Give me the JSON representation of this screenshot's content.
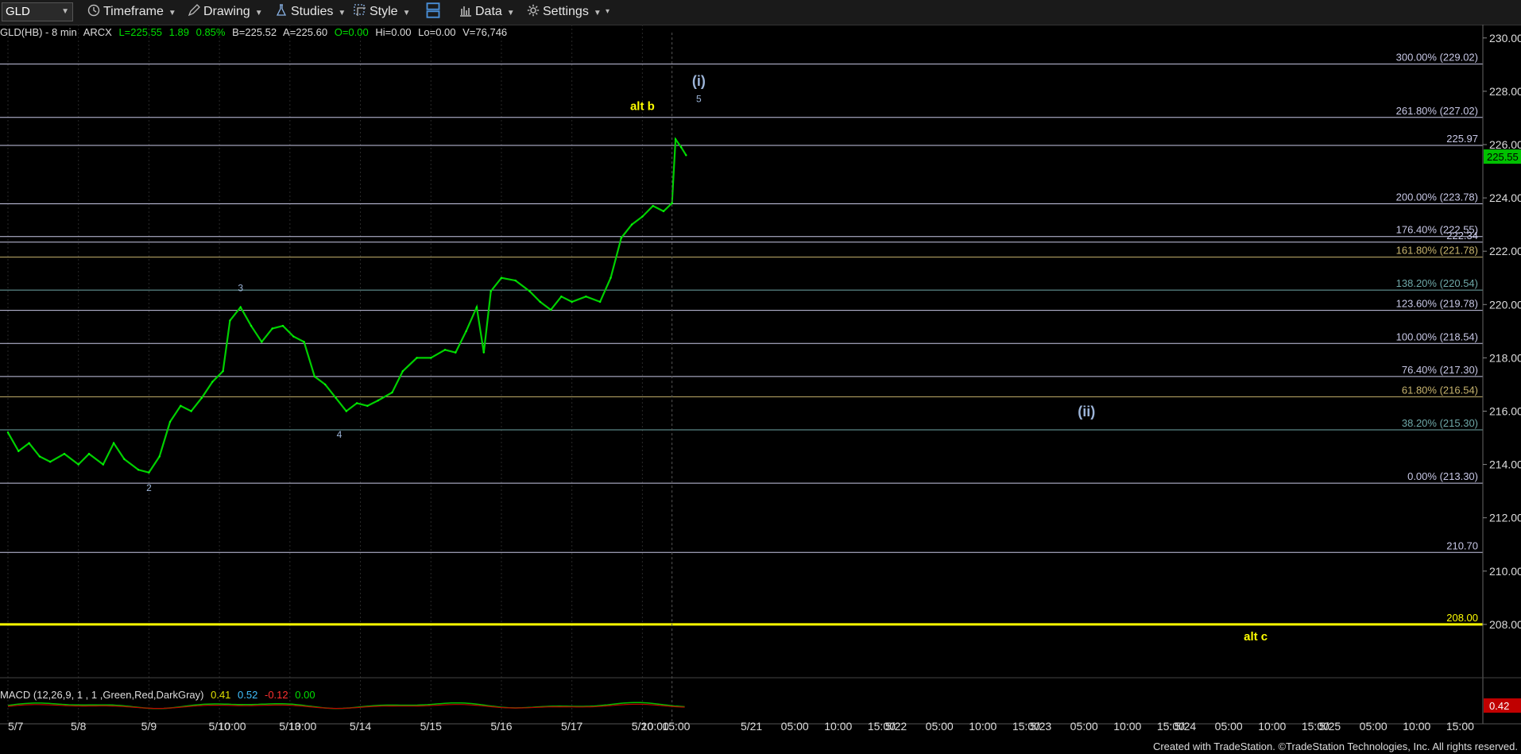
{
  "toolbar": {
    "symbol": "GLD",
    "timeframe": "Timeframe",
    "drawing": "Drawing",
    "studies": "Studies",
    "style": "Style",
    "data": "Data",
    "settings": "Settings"
  },
  "legend": {
    "name": "GLD(HB) - 8 min",
    "exchange": "ARCX",
    "last": "L=225.55",
    "change": "1.89",
    "change_pct": "0.85%",
    "bid": "B=225.52",
    "ask": "A=225.60",
    "open": "O=0.00",
    "high": "Hi=0.00",
    "low": "Lo=0.00",
    "volume": "V=76,746"
  },
  "macd": {
    "label": "MACD (12,26,9, 1 , 1 ,Green,Red,DarkGray)",
    "v1": "0.41",
    "v2": "0.52",
    "v3": "-0.12",
    "v4": "0.00",
    "last_tag": "0.42"
  },
  "price_axis": {
    "ticks": [
      "230.00",
      "228.00",
      "226.00",
      "224.00",
      "222.00",
      "220.00",
      "218.00",
      "216.00",
      "214.00",
      "212.00",
      "210.00",
      "208.00"
    ],
    "last_price": "225.55",
    "last_color": "#00c000"
  },
  "time_axis": {
    "labels": [
      {
        "t": "5/7",
        "x": 0.0
      },
      {
        "t": "5/8",
        "x": 1.0
      },
      {
        "t": "5/9",
        "x": 2.0
      },
      {
        "t": "5/10",
        "x": 3.0
      },
      {
        "t": "10:00",
        "x": 3.18
      },
      {
        "t": "5/13",
        "x": 4.0
      },
      {
        "t": "10:00",
        "x": 4.18
      },
      {
        "t": "5/14",
        "x": 5.0
      },
      {
        "t": "5/15",
        "x": 6.0
      },
      {
        "t": "5/16",
        "x": 7.0
      },
      {
        "t": "5/17",
        "x": 8.0
      },
      {
        "t": "5/20",
        "x": 9.0
      },
      {
        "t": "10:00",
        "x": 9.18
      },
      {
        "t": "15:00",
        "x": 9.48
      },
      {
        "t": "5/21",
        "x": 10.0
      },
      {
        "t": "05:00",
        "x": 10.3
      },
      {
        "t": "10:00",
        "x": 10.6
      },
      {
        "t": "15:00",
        "x": 10.9
      },
      {
        "t": "5/22",
        "x": 11.0
      },
      {
        "t": "05:00",
        "x": 11.3
      },
      {
        "t": "10:00",
        "x": 11.6
      },
      {
        "t": "15:00",
        "x": 11.9
      },
      {
        "t": "5/23",
        "x": 12.0
      },
      {
        "t": "05:00",
        "x": 12.3
      },
      {
        "t": "10:00",
        "x": 12.6
      },
      {
        "t": "15:00",
        "x": 12.9
      },
      {
        "t": "5/24",
        "x": 13.0
      },
      {
        "t": "05:00",
        "x": 13.3
      },
      {
        "t": "10:00",
        "x": 13.6
      },
      {
        "t": "15:00",
        "x": 13.9
      },
      {
        "t": "5/25",
        "x": 14.0
      },
      {
        "t": "05:00",
        "x": 14.3
      },
      {
        "t": "10:00",
        "x": 14.6
      },
      {
        "t": "15:00",
        "x": 14.9
      }
    ]
  },
  "levels": [
    {
      "label": "300.00% (229.02)",
      "price": 229.02,
      "color": "#c8c8e6"
    },
    {
      "label": "261.80% (227.02)",
      "price": 227.02,
      "color": "#c8c8e6"
    },
    {
      "label": "225.97",
      "price": 225.97,
      "color": "#c8c8e6"
    },
    {
      "label": "200.00% (223.78)",
      "price": 223.78,
      "color": "#c8c8e6"
    },
    {
      "label": "176.40% (222.55)",
      "price": 222.55,
      "color": "#c8c8e6"
    },
    {
      "label": "222.34",
      "price": 222.34,
      "color": "#c8c8e6"
    },
    {
      "label": "161.80% (221.78)",
      "price": 221.78,
      "color": "#c8b46e"
    },
    {
      "label": "138.20% (220.54)",
      "price": 220.54,
      "color": "#6fa8a8"
    },
    {
      "label": "123.60% (219.78)",
      "price": 219.78,
      "color": "#c8c8e6"
    },
    {
      "label": "100.00% (218.54)",
      "price": 218.54,
      "color": "#c8c8e6"
    },
    {
      "label": "76.40% (217.30)",
      "price": 217.3,
      "color": "#c8c8e6"
    },
    {
      "label": "61.80% (216.54)",
      "price": 216.54,
      "color": "#c8b46e"
    },
    {
      "label": "38.20% (215.30)",
      "price": 215.3,
      "color": "#6fa8a8"
    },
    {
      "label": "0.00% (213.30)",
      "price": 213.3,
      "color": "#c8c8e6"
    },
    {
      "label": "210.70",
      "price": 210.7,
      "color": "#c8c8e6"
    },
    {
      "label": "208.00",
      "price": 208.0,
      "color": "#ffff00"
    }
  ],
  "annotations": [
    {
      "text": "2",
      "day": 2.0,
      "price": 213.0,
      "color": "#9cb4d8",
      "size": 12
    },
    {
      "text": "3",
      "day": 3.3,
      "price": 220.5,
      "color": "#9cb4d8",
      "size": 12
    },
    {
      "text": "4",
      "day": 4.7,
      "price": 215.0,
      "color": "#9cb4d8",
      "size": 12
    },
    {
      "text": "alt b",
      "day": 9.0,
      "price": 227.3,
      "color": "#ffff00",
      "size": 15
    },
    {
      "text": "(i)",
      "day": 9.8,
      "price": 228.2,
      "color": "#9cb4d8",
      "size": 18
    },
    {
      "text": "5",
      "day": 9.8,
      "price": 227.6,
      "color": "#9cb4d8",
      "size": 12
    },
    {
      "text": "(ii)",
      "day": 15.3,
      "price": 215.8,
      "color": "#9cb4d8",
      "size": 18
    },
    {
      "text": "alt c",
      "day": 17.7,
      "price": 207.4,
      "color": "#ffff00",
      "size": 15
    }
  ],
  "chart_data": {
    "type": "line",
    "title": "GLD(HB) - 8 min",
    "price_range": [
      206,
      230.5
    ],
    "x_domain": [
      0,
      20.9
    ],
    "series": [
      {
        "points": [
          [
            0.0,
            215.2
          ],
          [
            0.15,
            214.5
          ],
          [
            0.3,
            214.8
          ],
          [
            0.45,
            214.3
          ],
          [
            0.6,
            214.1
          ],
          [
            0.8,
            214.4
          ],
          [
            1.0,
            214.0
          ],
          [
            1.15,
            214.4
          ],
          [
            1.35,
            214.0
          ],
          [
            1.5,
            214.8
          ],
          [
            1.65,
            214.2
          ],
          [
            1.85,
            213.8
          ],
          [
            2.0,
            213.7
          ],
          [
            2.15,
            214.3
          ],
          [
            2.3,
            215.6
          ],
          [
            2.45,
            216.2
          ],
          [
            2.6,
            216.0
          ],
          [
            2.75,
            216.5
          ],
          [
            2.9,
            217.1
          ],
          [
            3.05,
            217.5
          ],
          [
            3.15,
            219.4
          ],
          [
            3.3,
            219.9
          ],
          [
            3.45,
            219.2
          ],
          [
            3.6,
            218.6
          ],
          [
            3.75,
            219.1
          ],
          [
            3.9,
            219.2
          ],
          [
            4.05,
            218.8
          ],
          [
            4.2,
            218.6
          ],
          [
            4.35,
            217.3
          ],
          [
            4.5,
            217.0
          ],
          [
            4.65,
            216.5
          ],
          [
            4.8,
            216.0
          ],
          [
            4.95,
            216.3
          ],
          [
            5.1,
            216.2
          ],
          [
            5.25,
            216.4
          ],
          [
            5.45,
            216.7
          ],
          [
            5.6,
            217.5
          ],
          [
            5.8,
            218.0
          ],
          [
            6.0,
            218.0
          ],
          [
            6.2,
            218.3
          ],
          [
            6.35,
            218.2
          ],
          [
            6.5,
            219.0
          ],
          [
            6.65,
            219.9
          ],
          [
            6.75,
            218.2
          ],
          [
            6.85,
            220.5
          ],
          [
            7.0,
            221.0
          ],
          [
            7.2,
            220.9
          ],
          [
            7.4,
            220.5
          ],
          [
            7.55,
            220.1
          ],
          [
            7.7,
            219.8
          ],
          [
            7.85,
            220.3
          ],
          [
            8.0,
            220.1
          ],
          [
            8.2,
            220.3
          ],
          [
            8.4,
            220.1
          ],
          [
            8.55,
            221.0
          ],
          [
            8.7,
            222.5
          ],
          [
            8.85,
            223.0
          ],
          [
            9.0,
            223.3
          ],
          [
            9.15,
            223.7
          ],
          [
            9.3,
            223.5
          ],
          [
            9.42,
            223.8
          ],
          [
            9.47,
            226.2
          ],
          [
            9.55,
            225.9
          ],
          [
            9.62,
            225.6
          ]
        ]
      }
    ],
    "macd": {
      "fast": 12,
      "slow": 26,
      "signal": 9
    }
  }
}
